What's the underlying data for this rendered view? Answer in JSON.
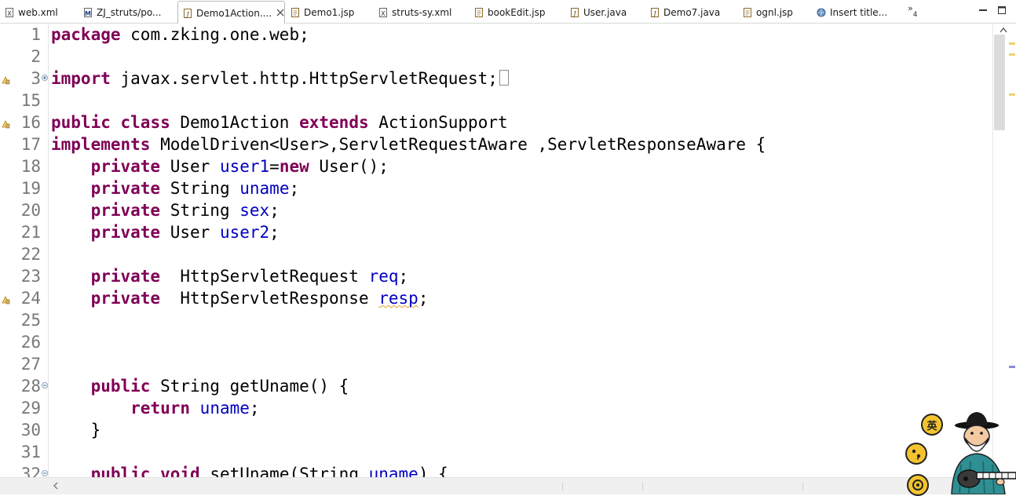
{
  "tabs": [
    {
      "label": "web.xml",
      "icon": "xml-file-icon",
      "active": false
    },
    {
      "label": "ZJ_struts/po...",
      "icon": "maven-pom-icon",
      "active": false
    },
    {
      "label": "Demo1Action....",
      "icon": "java-file-icon",
      "active": true
    },
    {
      "label": "Demo1.jsp",
      "icon": "jsp-file-icon",
      "active": false
    },
    {
      "label": "struts-sy.xml",
      "icon": "xml-file-icon",
      "active": false
    },
    {
      "label": "bookEdit.jsp",
      "icon": "jsp-file-icon",
      "active": false
    },
    {
      "label": "User.java",
      "icon": "java-file-icon",
      "active": false
    },
    {
      "label": "Demo7.java",
      "icon": "java-file-icon",
      "active": false
    },
    {
      "label": "ognl.jsp",
      "icon": "jsp-file-icon",
      "active": false
    },
    {
      "label": "Insert title...",
      "icon": "web-browser-icon",
      "active": false
    }
  ],
  "tab_overflow": {
    "symbol": "»",
    "count": "4"
  },
  "code_lines": [
    {
      "num": "1",
      "text": "package com.zking.one.web;"
    },
    {
      "num": "2",
      "text": ""
    },
    {
      "num": "3",
      "text": "import javax.servlet.http.HttpServletRequest;",
      "fold": "+",
      "warning": true
    },
    {
      "num": "15",
      "text": ""
    },
    {
      "num": "16",
      "text": "public class Demo1Action extends ActionSupport",
      "warning": true
    },
    {
      "num": "17",
      "text": "implements ModelDriven<User>,ServletRequestAware ,ServletResponseAware {"
    },
    {
      "num": "18",
      "text": "    private User user1=new User();"
    },
    {
      "num": "19",
      "text": "    private String uname;"
    },
    {
      "num": "20",
      "text": "    private String sex;"
    },
    {
      "num": "21",
      "text": "    private User user2;"
    },
    {
      "num": "22",
      "text": ""
    },
    {
      "num": "23",
      "text": "    private  HttpServletRequest req;"
    },
    {
      "num": "24",
      "text": "    private  HttpServletResponse resp;",
      "warning": true
    },
    {
      "num": "25",
      "text": ""
    },
    {
      "num": "26",
      "text": ""
    },
    {
      "num": "27",
      "text": ""
    },
    {
      "num": "28",
      "text": "    public String getUname() {",
      "fold": "-"
    },
    {
      "num": "29",
      "text": "        return uname;"
    },
    {
      "num": "30",
      "text": "    }"
    },
    {
      "num": "31",
      "text": ""
    },
    {
      "num": "32",
      "text": "    public void setUname(String uname) {",
      "fold": "-"
    }
  ],
  "mascot": {
    "badge_text": "英",
    "icons": [
      "chinese-input-icon",
      "punctuation-icon",
      "settings-disc-icon"
    ]
  },
  "colors": {
    "keyword": "#7f0055",
    "field": "#0000c0",
    "line_number": "#787878",
    "warning": "#e0a020"
  }
}
